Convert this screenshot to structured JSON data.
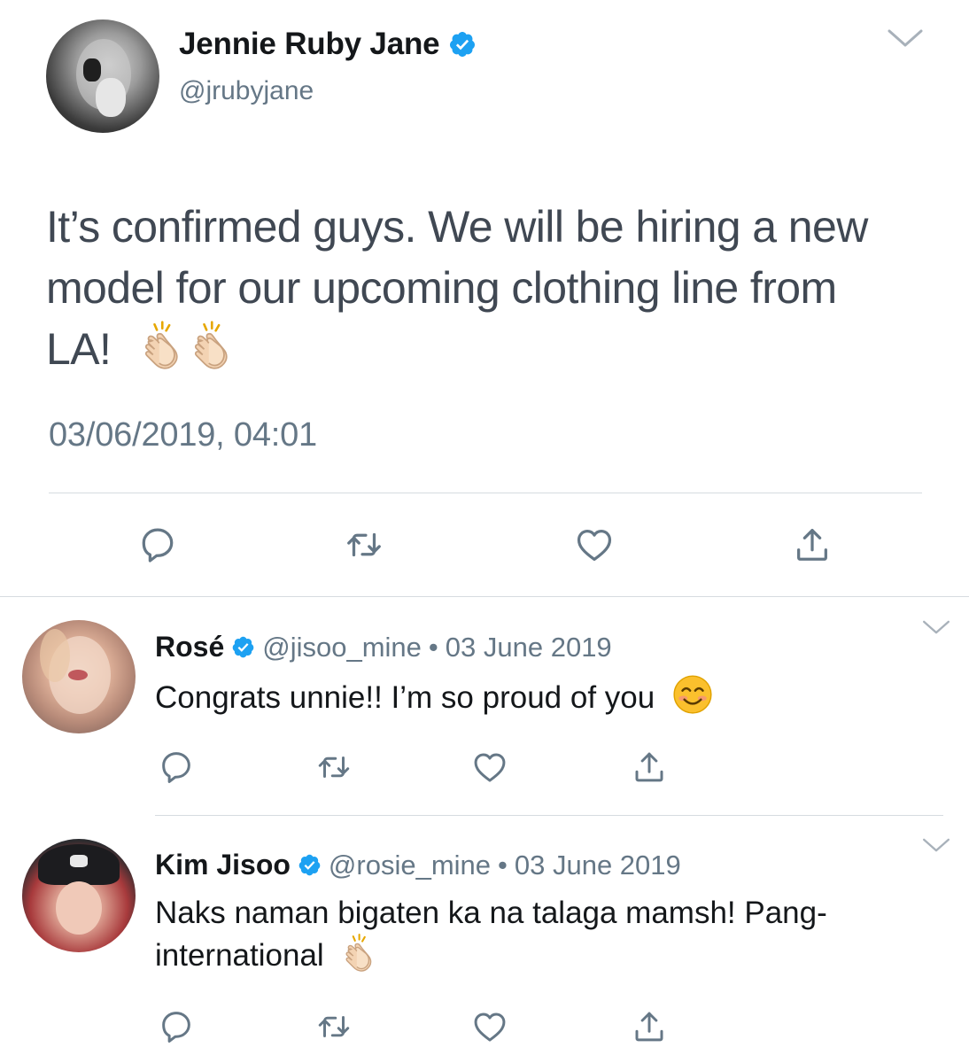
{
  "main_tweet": {
    "display_name": "Jennie Ruby Jane",
    "handle": "@jrubyjane",
    "text": "It’s confirmed guys. We will be hiring a new model for our upcoming clothing line from LA!",
    "emojis": [
      "clapping-hands",
      "clapping-hands"
    ],
    "timestamp": "03/06/2019, 04:01",
    "actions": [
      "reply",
      "retweet",
      "like",
      "share"
    ]
  },
  "replies": [
    {
      "display_name": "Rosé",
      "handle": "@jisoo_mine",
      "separator": "•",
      "date": "03 June 2019",
      "text": "Congrats unnie!! I’m so proud of you",
      "emoji": "smiling-face"
    },
    {
      "display_name": "Kim Jisoo",
      "handle": "@rosie_mine",
      "separator": "•",
      "date": "03 June 2019",
      "text": "Naks naman bigaten ka na talaga mamsh! Pang-international",
      "emoji": "clapping-hands"
    }
  ],
  "colors": {
    "verified_blue": "#1da1f2",
    "secondary_text": "#657786",
    "icon_gray": "#657786",
    "divider": "#d6dbe0"
  }
}
